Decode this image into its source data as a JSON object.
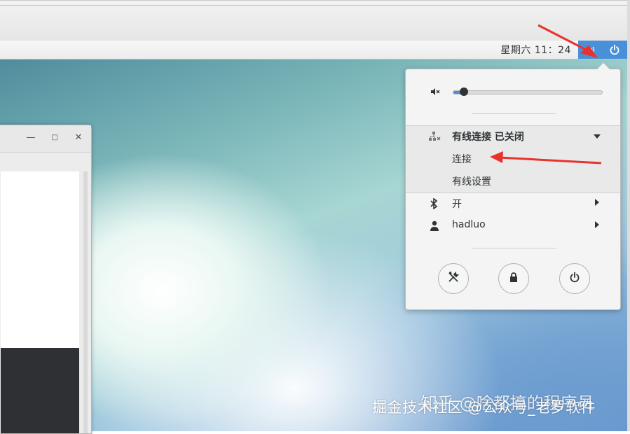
{
  "topbar": {
    "clock": "星期六 11：24"
  },
  "system_menu": {
    "volume_level": 0.07,
    "network": {
      "title": "有线连接 已关闭",
      "connect": "连接",
      "settings": "有线设置"
    },
    "bluetooth": {
      "label": "开"
    },
    "user": {
      "label": "hadluo"
    }
  },
  "watermark": {
    "line1": "掘金技术社区 @公众号_老罗软件",
    "line2": "知乎 @啥都搞的程序员"
  },
  "colors": {
    "accent": "#4a90d9",
    "annotation": "#e8322d"
  }
}
